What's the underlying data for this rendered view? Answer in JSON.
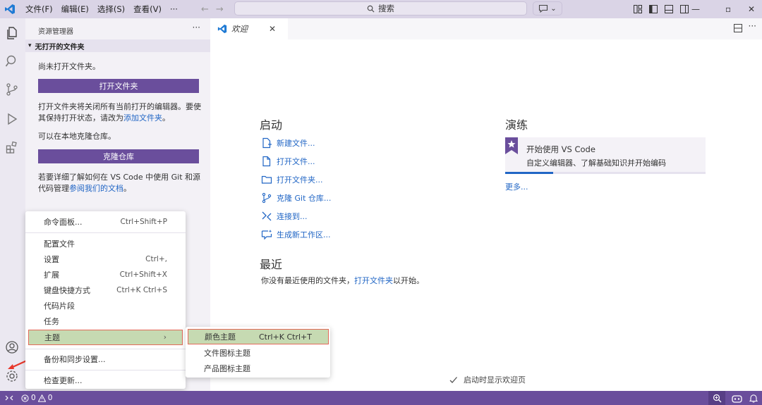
{
  "titlebar": {
    "menus": [
      "文件(F)",
      "编辑(E)",
      "选择(S)",
      "查看(V)",
      "···"
    ],
    "search_label": "搜索"
  },
  "sidebar": {
    "title": "资源管理器",
    "section": "无打开的文件夹",
    "no_folder_text": "尚未打开文件夹。",
    "open_folder_button": "打开文件夹",
    "note_text": "打开文件夹将关闭所有当前打开的编辑器。要使其保持打开状态，请改为",
    "add_folder_link": "添加文件夹",
    "note_end": "。",
    "clone_text": "可以在本地克隆仓库。",
    "clone_button": "克隆仓库",
    "git_text": "若要详细了解如何在 VS Code 中使用 Git 和源代码管理",
    "docs_link": "参阅我们的文档",
    "git_end": "。"
  },
  "tab": {
    "label": "欢迎"
  },
  "welcome": {
    "start_heading": "启动",
    "start_items": [
      "新建文件...",
      "打开文件...",
      "打开文件夹...",
      "克隆 Git 仓库...",
      "连接到...",
      "生成新工作区..."
    ],
    "walkthrough_heading": "演练",
    "walkthrough_title": "开始使用 VS Code",
    "walkthrough_desc": "自定义编辑器、了解基础知识并开始编码",
    "walkthrough_progress": 0.24,
    "more_link": "更多...",
    "recent_heading": "最近",
    "recent_text": "你没有最近使用的文件夹，",
    "recent_link": "打开文件夹",
    "recent_end": "以开始。",
    "show_on_startup": "启动时显示欢迎页"
  },
  "manage_menu": {
    "items": [
      {
        "label": "命令面板...",
        "shortcut": "Ctrl+Shift+P"
      },
      {
        "label": "配置文件",
        "shortcut": ""
      },
      {
        "label": "设置",
        "shortcut": "Ctrl+,"
      },
      {
        "label": "扩展",
        "shortcut": "Ctrl+Shift+X"
      },
      {
        "label": "键盘快捷方式",
        "shortcut": "Ctrl+K Ctrl+S"
      },
      {
        "label": "代码片段",
        "shortcut": ""
      },
      {
        "label": "任务",
        "shortcut": ""
      },
      {
        "label": "主题",
        "shortcut": "›"
      },
      {
        "label": "备份和同步设置...",
        "shortcut": ""
      },
      {
        "label": "检查更新...",
        "shortcut": ""
      }
    ]
  },
  "theme_submenu": {
    "items": [
      {
        "label": "颜色主题",
        "shortcut": "Ctrl+K Ctrl+T"
      },
      {
        "label": "文件图标主题",
        "shortcut": ""
      },
      {
        "label": "产品图标主题",
        "shortcut": ""
      }
    ]
  },
  "statusbar": {
    "errors": "0",
    "warnings": "0"
  },
  "colors": {
    "accent": "#6a4e9c",
    "link": "#2166c5",
    "highlight": "#c6dab2",
    "annotation": "#e36a5a"
  }
}
